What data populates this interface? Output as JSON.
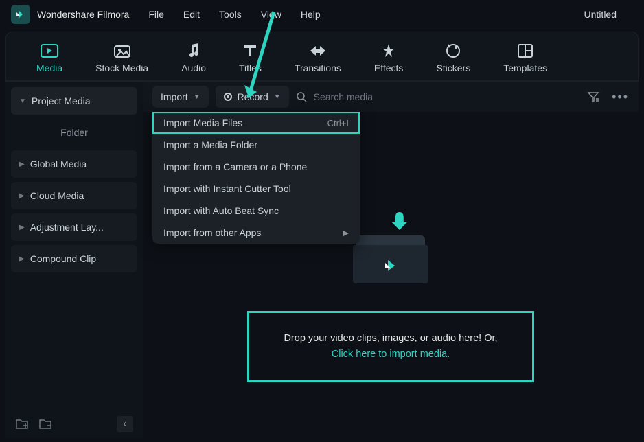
{
  "app": {
    "name": "Wondershare Filmora",
    "project_title": "Untitled"
  },
  "menubar": [
    "File",
    "Edit",
    "Tools",
    "View",
    "Help"
  ],
  "tabs": [
    {
      "label": "Media",
      "active": true
    },
    {
      "label": "Stock Media"
    },
    {
      "label": "Audio"
    },
    {
      "label": "Titles"
    },
    {
      "label": "Transitions"
    },
    {
      "label": "Effects"
    },
    {
      "label": "Stickers"
    },
    {
      "label": "Templates"
    }
  ],
  "sidebar": {
    "project": "Project Media",
    "folder": "Folder",
    "items": [
      "Global Media",
      "Cloud Media",
      "Adjustment Lay...",
      "Compound Clip"
    ]
  },
  "toolbar": {
    "import_label": "Import",
    "record_label": "Record",
    "search_placeholder": "Search media"
  },
  "dropdown": [
    {
      "label": "Import Media Files",
      "shortcut": "Ctrl+I",
      "highlighted": true
    },
    {
      "label": "Import a Media Folder"
    },
    {
      "label": "Import from a Camera or a Phone"
    },
    {
      "label": "Import with Instant Cutter Tool"
    },
    {
      "label": "Import with Auto Beat Sync"
    },
    {
      "label": "Import from other Apps",
      "submenu": true
    }
  ],
  "dropzone": {
    "text": "Drop your video clips, images, or audio here! Or,",
    "link": "Click here to import media."
  }
}
